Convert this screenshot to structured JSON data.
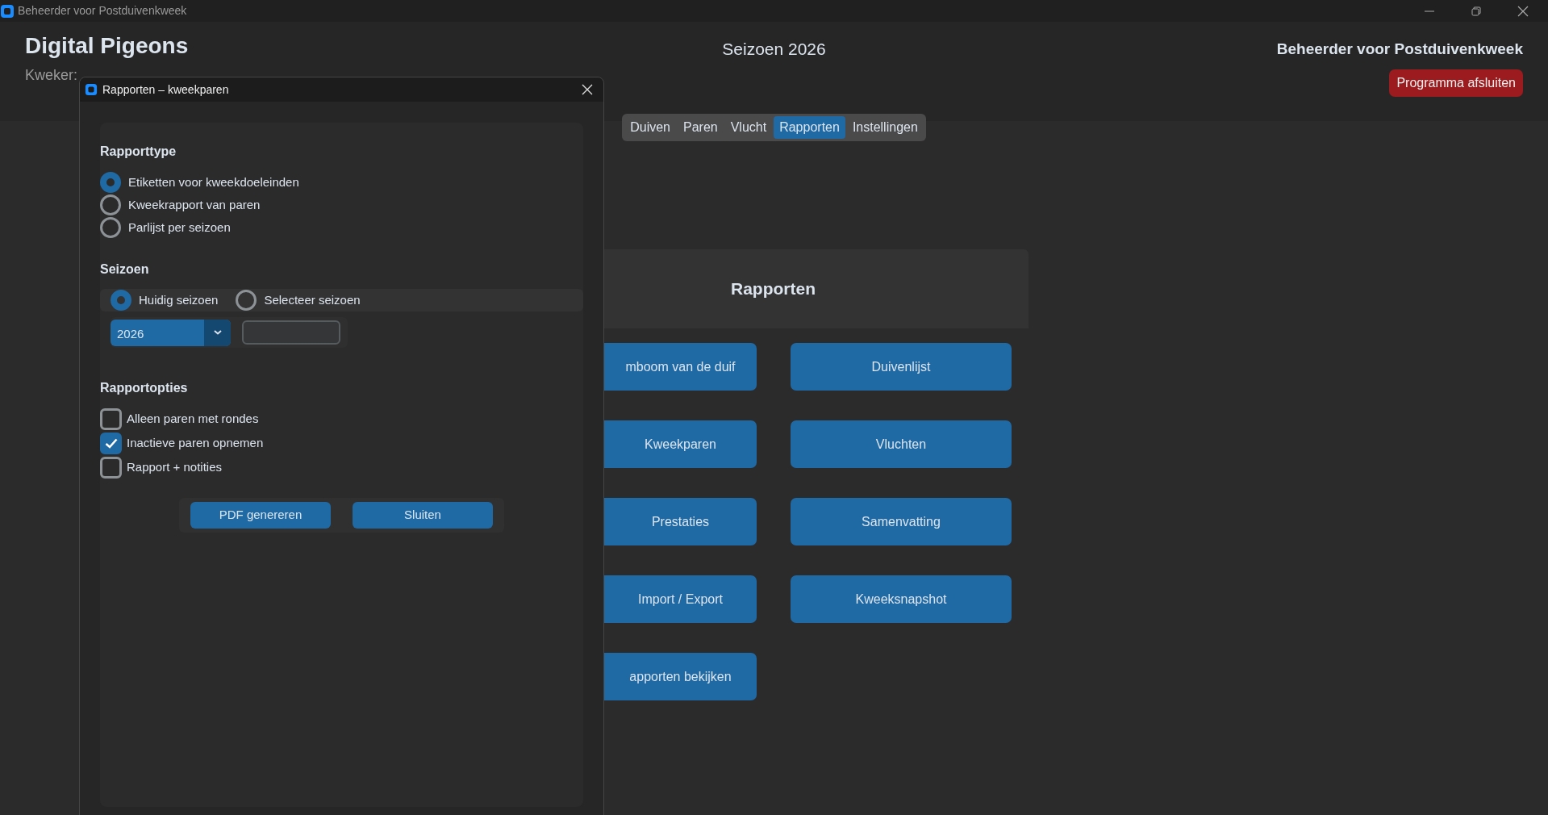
{
  "window": {
    "title": "Beheerder voor Postduivenkweek"
  },
  "header": {
    "app_name": "Digital Pigeons",
    "breeder_label": "Kweker:",
    "season": "Seizoen 2026",
    "app_title": "Beheerder voor Postduivenkweek",
    "exit_button": "Programma afsluiten"
  },
  "tabs": [
    {
      "label": "Duiven",
      "selected": false
    },
    {
      "label": "Paren",
      "selected": false
    },
    {
      "label": "Vlucht",
      "selected": false
    },
    {
      "label": "Rapporten",
      "selected": true
    },
    {
      "label": "Instellingen",
      "selected": false
    }
  ],
  "reports_panel": {
    "title": "Rapporten",
    "buttons": [
      "mboom van de duif",
      "Duivenlijst",
      "Kweekparen",
      "Vluchten",
      "Prestaties",
      "Samenvatting",
      "Import / Export",
      "Kweeksnapshot",
      "apporten bekijken"
    ]
  },
  "dialog": {
    "title": "Rapporten – kweekparen",
    "report_type": {
      "heading": "Rapporttype",
      "options": [
        {
          "label": "Etiketten voor kweekdoeleinden",
          "selected": true
        },
        {
          "label": "Kweekrapport van paren",
          "selected": false
        },
        {
          "label": "Parlijst per seizoen",
          "selected": false
        }
      ]
    },
    "season": {
      "heading": "Seizoen",
      "options": [
        {
          "label": "Huidig seizoen",
          "selected": true
        },
        {
          "label": "Selecteer seizoen",
          "selected": false
        }
      ],
      "year_select": "2026"
    },
    "report_options": {
      "heading": "Rapportopties",
      "checkboxes": [
        {
          "label": "Alleen paren met rondes",
          "checked": false
        },
        {
          "label": "Inactieve paren opnemen",
          "checked": true
        },
        {
          "label": "Rapport + notities",
          "checked": false
        }
      ]
    },
    "buttons": [
      "PDF genereren",
      "Sluiten"
    ]
  }
}
